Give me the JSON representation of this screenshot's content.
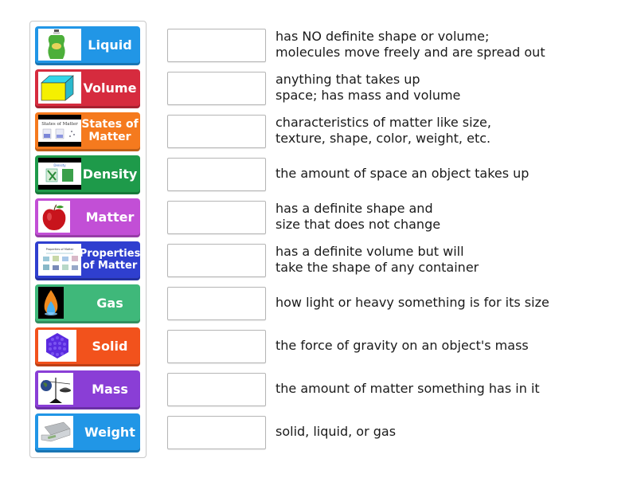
{
  "tiles": [
    {
      "label": "Liquid",
      "image": "dish-soap-bottle",
      "color": "#2196e6"
    },
    {
      "label": "Volume",
      "image": "rectangular-prism",
      "color": "#d62b3e"
    },
    {
      "label": "States of Matter",
      "image": "states-of-matter-diagram",
      "color": "#f57a1e"
    },
    {
      "label": "Density",
      "image": "density-diagram",
      "color": "#1e9a4a"
    },
    {
      "label": "Matter",
      "image": "red-apple",
      "color": "#c24fd6"
    },
    {
      "label": "Properties of Matter",
      "image": "properties-of-matter-chart",
      "color": "#2f3fcf"
    },
    {
      "label": "Gas",
      "image": "gas-flame",
      "color": "#3fb87a"
    },
    {
      "label": "Solid",
      "image": "sphere-cluster",
      "color": "#f2521c"
    },
    {
      "label": "Mass",
      "image": "balance-scale",
      "color": "#8a3ed6"
    },
    {
      "label": "Weight",
      "image": "digital-scale",
      "color": "#2196e6"
    }
  ],
  "definitions": [
    "has NO definite shape or volume;\nmolecules move freely and are spread out",
    "anything that takes up\nspace; has mass and volume",
    "characteristics of matter like size,\ntexture, shape, color, weight, etc.",
    "the amount of space an object takes up",
    "has a definite shape and\nsize that does not change",
    "has a definite volume but will\ntake the shape of any container",
    "how light or heavy something is for its size",
    "the force of gravity on an object's mass",
    "the amount of matter something has in it",
    "solid, liquid, or gas"
  ]
}
